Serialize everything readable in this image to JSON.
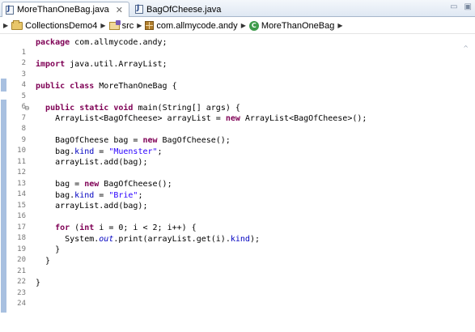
{
  "tabs": [
    {
      "label": "MoreThanOneBag.java",
      "close": "✕",
      "active": true
    },
    {
      "label": "BagOfCheese.java",
      "active": false
    }
  ],
  "window_controls": {
    "minimize": "▭",
    "maximize": "▣"
  },
  "breadcrumb": {
    "project": "CollectionsDemo4",
    "src": "src",
    "package": "com.allmycode.andy",
    "class": "MoreThanOneBag",
    "class_icon": "C",
    "separator": "▶"
  },
  "code": {
    "line_numbers": [
      "1",
      "2",
      "3",
      "4",
      "5",
      "6",
      "7",
      "8",
      "9",
      "10",
      "11",
      "12",
      "13",
      "14",
      "15",
      "16",
      "17",
      "18",
      "19",
      "20",
      "21",
      "22",
      "23",
      "24"
    ],
    "fold_marker": "⊖",
    "l1": {
      "kw": "package",
      "rest": " com.allmycode.andy;"
    },
    "l3": {
      "kw": "import",
      "rest": " java.util.ArrayList;"
    },
    "l5": {
      "kw1": "public",
      "kw2": "class",
      "rest": " MoreThanOneBag {"
    },
    "l7": {
      "kw1": "public",
      "kw2": "static",
      "kw3": "void",
      "rest": " main(String[] args) {"
    },
    "l8": {
      "pre": "    ArrayList<BagOfCheese> arrayList = ",
      "kw": "new",
      "rest": " ArrayList<BagOfCheese>();"
    },
    "l10": {
      "pre": "    BagOfCheese bag = ",
      "kw": "new",
      "rest": " BagOfCheese();"
    },
    "l11": {
      "pre": "    bag.",
      "field": "kind",
      "mid": " = ",
      "str": "\"Muenster\"",
      "rest": ";"
    },
    "l12": {
      "text": "    arrayList.add(bag);"
    },
    "l14": {
      "pre": "    bag = ",
      "kw": "new",
      "rest": " BagOfCheese();"
    },
    "l15": {
      "pre": "    bag.",
      "field": "kind",
      "mid": " = ",
      "str": "\"Brie\"",
      "rest": ";"
    },
    "l16": {
      "text": "    arrayList.add(bag);"
    },
    "l18": {
      "pre": "    ",
      "kw": "for",
      "mid": " (",
      "kw2": "int",
      "rest": " i = 0; i < 2; i++) {"
    },
    "l19": {
      "pre": "      System.",
      "static": "out",
      "mid": ".print(arrayList.get(i).",
      "field": "kind",
      "rest": ");"
    },
    "l20": {
      "text": "    }"
    },
    "l21": {
      "text": "  }"
    },
    "l23": {
      "text": "}"
    }
  }
}
